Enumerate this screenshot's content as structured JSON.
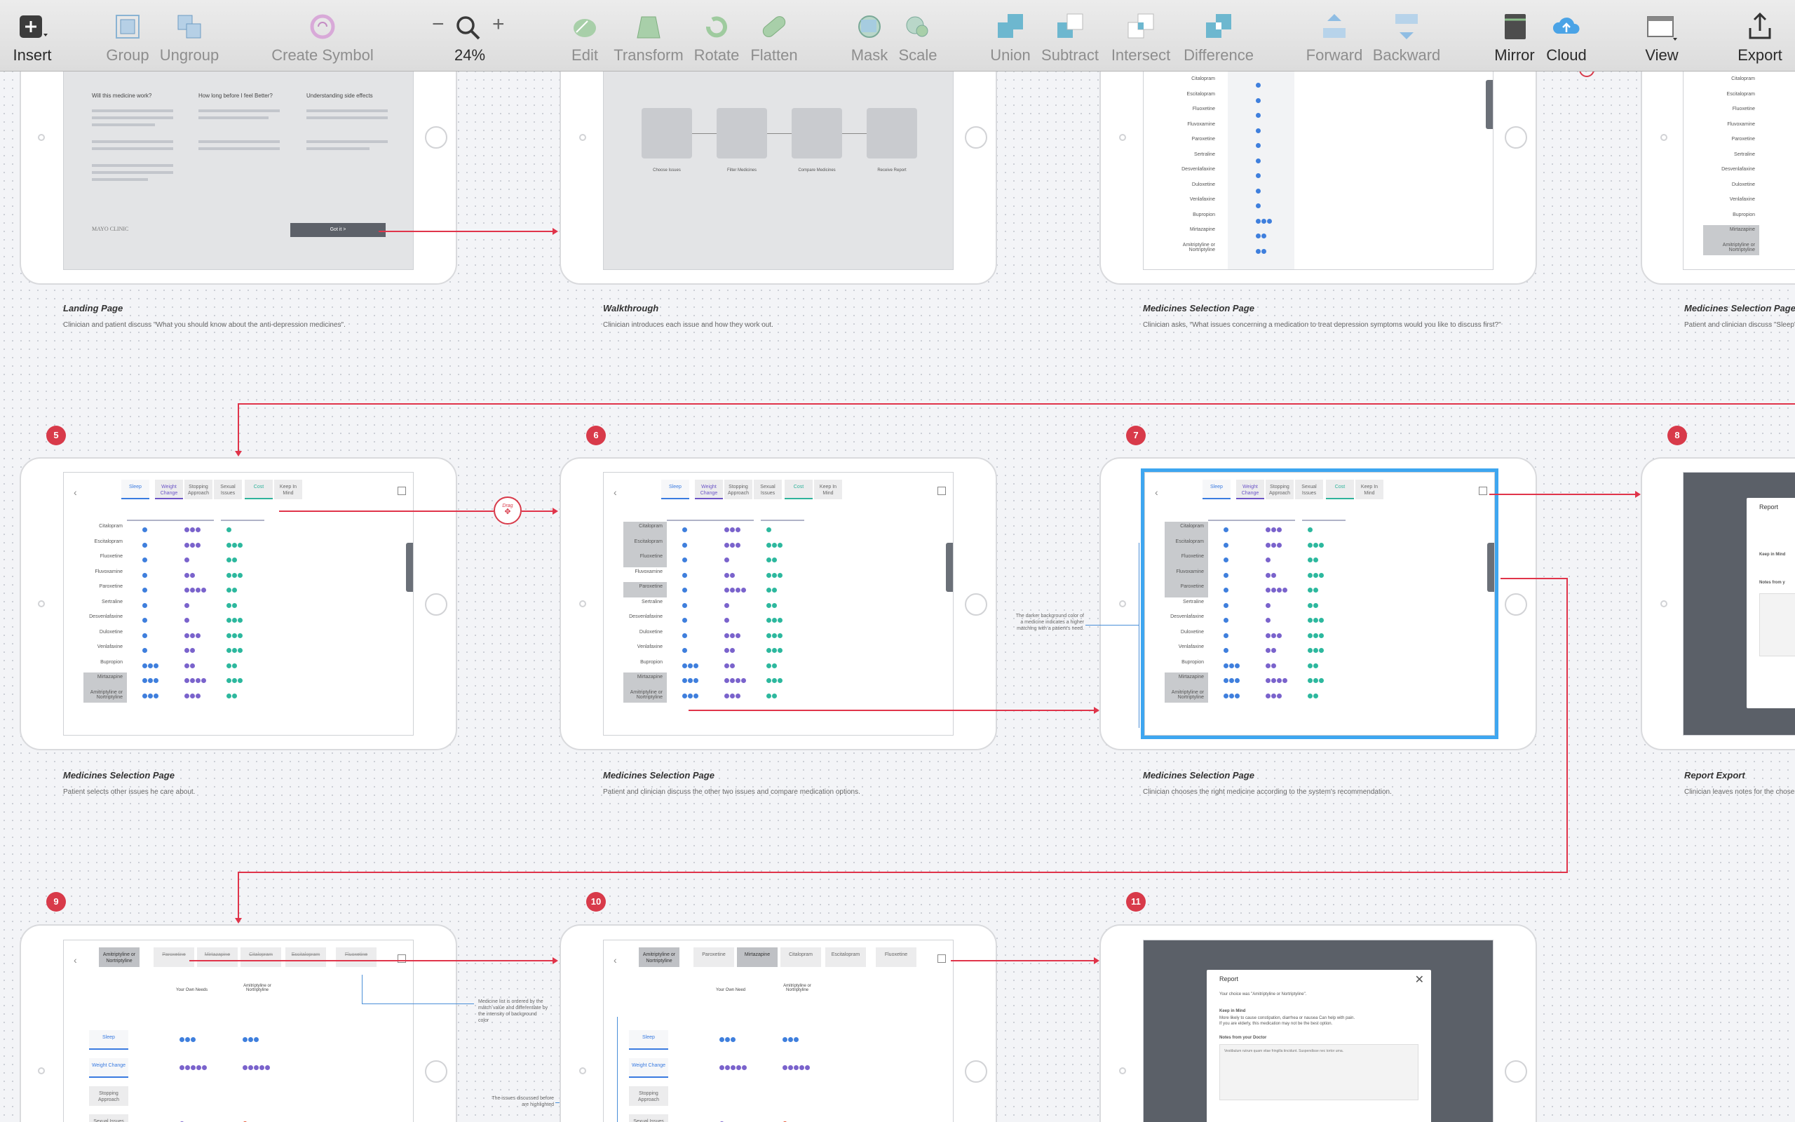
{
  "toolbar": {
    "insert": "Insert",
    "group": "Group",
    "ungroup": "Ungroup",
    "create_symbol": "Create Symbol",
    "zoom_minus": "−",
    "zoom_plus": "+",
    "zoom_value": "24%",
    "edit": "Edit",
    "transform": "Transform",
    "rotate": "Rotate",
    "flatten": "Flatten",
    "mask": "Mask",
    "scale": "Scale",
    "union": "Union",
    "subtract": "Subtract",
    "intersect": "Intersect",
    "difference": "Difference",
    "forward": "Forward",
    "backward": "Backward",
    "mirror": "Mirror",
    "cloud": "Cloud",
    "view": "View",
    "export": "Export"
  },
  "artboards": {
    "a1": {
      "title": "Landing Page",
      "desc": "Clinician and patient discuss \"What you should know about the anti-depression medicines\".",
      "h1": "Will this medicine work?",
      "h2": "How long before I feel Better?",
      "h3": "Understanding side effects",
      "logo": "MAYO CLINIC",
      "cta": "Got it >"
    },
    "a2": {
      "title": "Walkthrough",
      "desc": "Clinician introduces each issue and how they work out.",
      "s1": "Choose Issues",
      "s2": "Filter Medicines",
      "s3": "Compare Medicines",
      "s4": "Receive Report"
    },
    "a3": {
      "title": "Medicines Selection Page",
      "desc": "Clinician asks, \"What issues concerning a medication to treat depression symptoms would you like to discuss first?\""
    },
    "a4": {
      "title": "Medicines Selection Page",
      "desc": "Patient and clinician discuss \"Sleep\" is"
    },
    "a5": {
      "badge": "5",
      "title": "Medicines Selection Page",
      "desc": "Patient selects other issues he care about.",
      "drag": "Drag"
    },
    "a6": {
      "badge": "6",
      "title": "Medicines Selection Page",
      "desc": "Patient and clinician discuss the other two issues and compare medication options."
    },
    "a7": {
      "badge": "7",
      "title": "Medicines Selection Page",
      "desc": "Clinician chooses the right medicine according to the system's recommendation.",
      "annotation": "The darker background color of a medicine indicates a higher matching with a patient's need."
    },
    "a8": {
      "badge": "8",
      "title": "Report Export",
      "desc": "Clinician leaves notes for the chosen",
      "modal_title": "Report",
      "keep": "Keep in Mind",
      "notes": "Notes from y"
    },
    "a9": {
      "badge": "9",
      "annotation1": "Medicine list is ordered by the match value and differentiate by the intensity of background color",
      "annotation2": "The issues discussed before are highlighted",
      "col1": "Your Own Needs",
      "col2": "Amitriptyline or Nortriptyline"
    },
    "a10": {
      "badge": "10",
      "col1": "Your Own Need",
      "col2": "Amitriptyline or Nortriptyline"
    },
    "a11": {
      "badge": "11",
      "modal_title": "Report",
      "choice": "Your choice was \"Amitriptyline or Nortriptyline\".",
      "keep": "Keep in Mind",
      "keep_text": "More likely to cause constipation, diarrhea or nausea Can help with pain.",
      "keep_text2": "If you are elderly, this medication may not be the best option.",
      "notes": "Notes from your Doctor",
      "notes_text": "Vestibulum rutrum quam vitae fringilla tincidunt. Suspendisse nec tortor urna."
    }
  },
  "tabs": [
    "Sleep",
    "Weight Change",
    "Stopping Approach",
    "Sexual Issues",
    "Cost",
    "Keep In Mind"
  ],
  "medicines": [
    "Citalopram",
    "Escitalopram",
    "Fluoxetine",
    "Fluvoxamine",
    "Paroxetine",
    "Sertraline",
    "Desvenlafaxine",
    "Duloxetine",
    "Venlafaxine",
    "Bupropion",
    "Mirtazapine",
    "Amitriptyline or Nortriptyline"
  ],
  "compare_tabs": [
    "Amitriptyline or Nortriptyline",
    "Paroxetine",
    "Mirtazapine",
    "Citalopram",
    "Escitalopram",
    "Fluoxetine"
  ],
  "side_issues": [
    "Sleep",
    "Weight Change",
    "Stopping Approach",
    "Sexual Issues"
  ],
  "colors": {
    "accent_red": "#d83a4a",
    "selection_blue": "#3ea6f0",
    "dot_blue": "#3f7fdd",
    "dot_purple": "#7a63cc",
    "dot_teal": "#2db89e",
    "dot_orange": "#e5512e"
  }
}
